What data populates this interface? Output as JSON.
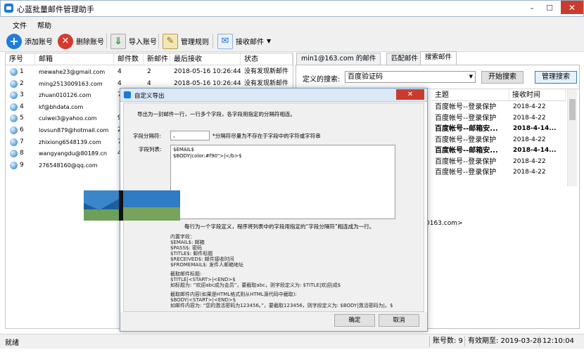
{
  "window": {
    "title": "心蓝批量邮件管理助手",
    "close_label": "✕"
  },
  "menu": [
    "文件",
    "帮助"
  ],
  "toolbar": {
    "add": "添加账号",
    "delete": "删除账号",
    "import": "导入账号",
    "rules": "管理规则",
    "receive": "接收邮件"
  },
  "accounts": {
    "headers": [
      "序号",
      "邮箱",
      "邮件数",
      "新邮件",
      "最后接收",
      "状态"
    ],
    "rows": [
      {
        "no": "1",
        "email": "mewahe23@gmail.com",
        "count": "4",
        "new": "2",
        "last": "2018-05-16 10:26:44",
        "status": "没有发现新邮件"
      },
      {
        "no": "2",
        "email": "ming2513009163.com",
        "count": "4",
        "new": "4",
        "last": "2018-05-16 10:26:44",
        "status": "没有发现新邮件"
      },
      {
        "no": "3",
        "email": "zhuan010126.com",
        "count": "7",
        "new": "",
        "last": "",
        "status": ""
      },
      {
        "no": "4",
        "email": "kf@bhdata.com",
        "count": "",
        "new": "",
        "last": "",
        "status": ""
      },
      {
        "no": "5",
        "email": "cuiwei3@yahoo.com",
        "count": "9",
        "new": "",
        "last": "",
        "status": ""
      },
      {
        "no": "6",
        "email": "lovsun879@hotmail.com",
        "count": "2",
        "new": "",
        "last": "",
        "status": ""
      },
      {
        "no": "7",
        "email": "zhixiong6548139.com",
        "count": "7",
        "new": "",
        "last": "",
        "status": ""
      },
      {
        "no": "8",
        "email": "wangyangdu@80189.cn",
        "count": "4",
        "new": "",
        "last": "",
        "status": ""
      },
      {
        "no": "9",
        "email": "276548160@qq.com",
        "count": "",
        "new": "",
        "last": "",
        "status": ""
      }
    ]
  },
  "right": {
    "tabs": [
      "min1@163.com 的邮件",
      "匹配邮件",
      "搜索邮件"
    ],
    "search_label": "定义的搜索:",
    "search_value": "百度验证码",
    "start_search": "开始搜索",
    "manage_search": "管理搜索",
    "headers": [
      "主题",
      "接收时间"
    ],
    "rows": [
      {
        "subject": "百度帐号--登录保护",
        "time": "2018-4-22",
        "bold": false
      },
      {
        "subject": "百度帐号--登录保护",
        "time": "2018-4-22",
        "bold": false
      },
      {
        "subject": "百度帐号--邮箱安...",
        "time": "2018-4-14...",
        "bold": true
      },
      {
        "subject": "百度帐号--登录保护",
        "time": "2018-4-22",
        "bold": false
      },
      {
        "subject": "百度帐号--邮箱安...",
        "time": "2018-4-14...",
        "bold": true
      },
      {
        "subject": "百度帐号--登录保护",
        "time": "2018-4-22",
        "bold": false
      },
      {
        "subject": "百度帐号--登录保护",
        "time": "2018-4-22",
        "bold": false
      }
    ],
    "preview_text": "0163.com>"
  },
  "dialog": {
    "title": "自定义导出",
    "intro": "导出为一封邮件一行，一行多个字段，各字段用指定的分隔符相连。",
    "delim_label": "字段分隔符:",
    "delim_value": ",",
    "delim_hint": "*分隔符尽量为不存在于字段中的字符或字符串",
    "fields_label": "字段列表:",
    "fields_line1": "$EMAIL$",
    "fields_line2": "$BODY|color:#f90\">|</b>$",
    "desc": "每行为一个字段定义，程序将列表中的字段用指定的“字段分隔符”相连成为一行。",
    "help": [
      "内置字段：",
      "$EMAIL$: 邮箱",
      "$PASS$: 密码",
      "$TITLE$: 邮件标题",
      "$RECEIVED$: 邮件接收时间",
      "$FROMEMAIL$: 发件人邮箱地址",
      "",
      "截取邮件标题:",
      "$TITLE|<START>|<END>$",
      "如标题为: “欢迎abc成为会员”，要截取abc，则字段定义为: $TITLE|欢迎|成$",
      "",
      "截取邮件内容(如果是HTML格式则从HTML源代码中截取):",
      "$BODY|<START>|<END>$",
      "如邮件内容为: “您的激活密码为123456。”，要截取123456，则字段定义为: $BODY|激活密码为|。$"
    ],
    "ok": "确定",
    "cancel": "取消"
  },
  "status": {
    "ready": "就绪",
    "accounts": "账号数: 9",
    "expiry": "有效期至: 2019-03-28",
    "time": "12:10:04"
  }
}
